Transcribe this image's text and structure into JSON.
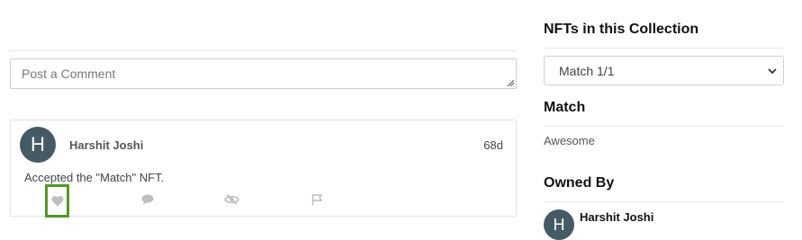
{
  "comment_form": {
    "placeholder": "Post a Comment"
  },
  "comment": {
    "avatar_letter": "H",
    "author": "Harshit Joshi",
    "time": "68d",
    "text": "Accepted the \"Match\" NFT."
  },
  "actions": [
    "heart-icon",
    "comment-icon",
    "hide-icon",
    "flag-icon"
  ],
  "sidebar": {
    "collection_title": "NFTs in this Collection",
    "selected_nft": "Match 1/1",
    "nft_name": "Match",
    "nft_description": "Awesome",
    "owned_by_title": "Owned By",
    "owner": {
      "avatar_letter": "H",
      "name": "Harshit Joshi"
    }
  },
  "colors": {
    "avatar": "#455a64",
    "highlight": "#4f9a27"
  }
}
